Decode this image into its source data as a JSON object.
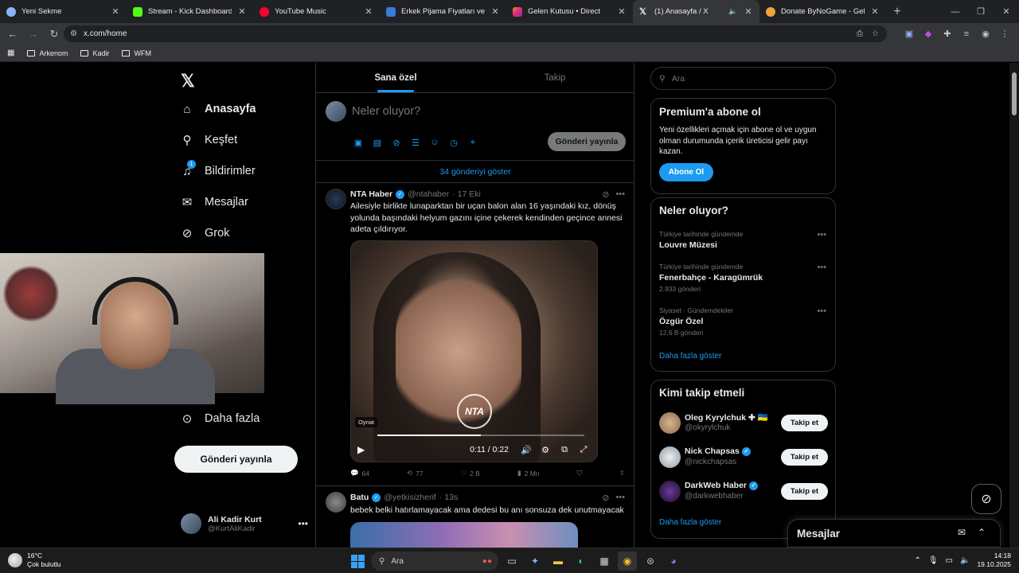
{
  "browser": {
    "tabs": [
      {
        "title": "Yeni Sekme",
        "color": "#8ab4f8"
      },
      {
        "title": "Stream - Kick Dashboard",
        "color": "#53fc18"
      },
      {
        "title": "YouTube Music",
        "color": "#ff0033"
      },
      {
        "title": "Erkek Pijama Fiyatları ve Modelleri",
        "color": "#3a7bd5"
      },
      {
        "title": "Gelen Kutusu • Direct",
        "color": "#e1306c"
      },
      {
        "title": "(1) Anasayfa / X",
        "color": "#e7e9ea",
        "active": true
      },
      {
        "title": "Donate ByNoGame - Gelen/Giden",
        "color": "#f2a33a"
      }
    ],
    "url": "x.com/home",
    "bookmarks": [
      "Arkenom",
      "Kadir",
      "WFM"
    ]
  },
  "nav": {
    "items": [
      {
        "label": "Anasayfa",
        "icon": "home-icon",
        "glyph": "⌂",
        "active": true
      },
      {
        "label": "Keşfet",
        "icon": "search-icon",
        "glyph": "⚲"
      },
      {
        "label": "Bildirimler",
        "icon": "bell-icon",
        "glyph": "🔔",
        "badge": "1"
      },
      {
        "label": "Mesajlar",
        "icon": "mail-icon",
        "glyph": "✉"
      },
      {
        "label": "Grok",
        "icon": "grok-icon",
        "glyph": "⊘"
      },
      {
        "label": "Daha fazla",
        "icon": "more-circle-icon",
        "glyph": "⊙"
      }
    ],
    "post_button": "Gönderi yayınla",
    "profile": {
      "name": "Ali Kadir Kurt",
      "handle": "@KurtAliKadir"
    }
  },
  "main": {
    "tabs": [
      "Sana özel",
      "Takip"
    ],
    "compose_placeholder": "Neler oluyor?",
    "compose_button": "Gönderi yayınla",
    "show_more": "34 gönderiyi göster",
    "tweets": [
      {
        "name": "NTA Haber",
        "handle": "@ntahaber",
        "time": "· 17 Eki",
        "text": "Ailesiyle birlikte lunaparktan bir uçan balon alan 16 yaşındaki kız, dönüş yolunda başındaki helyum gazını içine çekerek kendinden geçince annesi adeta çıldırıyor.",
        "video": {
          "badge": "Oynat",
          "logo": "NTA",
          "time": "0:11 / 0:22",
          "progress": 0.5
        },
        "stats": {
          "replies": "64",
          "reposts": "77",
          "likes": "2 B",
          "views": "2 Mn"
        }
      },
      {
        "name": "Batu",
        "handle": "@yetkisizherif",
        "time": "· 13s",
        "text": "bebek belki hatırlamayacak ama dedesi bu anı sonsuza dek unutmayacak"
      }
    ]
  },
  "right": {
    "search_placeholder": "Ara",
    "premium": {
      "title": "Premium'a abone ol",
      "text": "Yeni özellikleri açmak için abone ol ve uygun olman durumunda içerik üreticisi gelir payı kazan.",
      "button": "Abone Ol"
    },
    "trends": {
      "title": "Neler oluyor?",
      "items": [
        {
          "category": "Türkiye tarihinde gündemde",
          "label": "Louvre Müzesi",
          "count": ""
        },
        {
          "category": "Türkiye tarihinde gündemde",
          "label": "Fenerbahçe - Karagümrük",
          "count": "2.933 gönderi"
        },
        {
          "category": "Siyaset · Gündemdekiler",
          "label": "Özgür Özel",
          "count": "12,6 B gönderi"
        }
      ],
      "more": "Daha fazla göster"
    },
    "who_to_follow": {
      "title": "Kimi takip etmeli",
      "items": [
        {
          "name": "Oleg Kyrylchuk ✚ 🇺🇦",
          "handle": "@okyrylchuk",
          "verified": false,
          "avatar_color": "#c9a27a"
        },
        {
          "name": "Nick Chapsas",
          "handle": "@nickchapsas",
          "verified": true,
          "avatar_color": "#d8dde2"
        },
        {
          "name": "DarkWeb Haber",
          "handle": "@darkwebhaber",
          "verified": true,
          "avatar_color": "#2b1a3d"
        }
      ],
      "follow_label": "Takip et",
      "more": "Daha fazla göster"
    },
    "messages_dock": "Mesajlar"
  },
  "taskbar": {
    "temp": "16°C",
    "weather": "Çok bulutlu",
    "search": "Ara",
    "time": "14:18",
    "date": "19.10.2025"
  },
  "colors": {
    "accent": "#1d9bf0",
    "background": "#000000",
    "border": "#2f3336"
  }
}
